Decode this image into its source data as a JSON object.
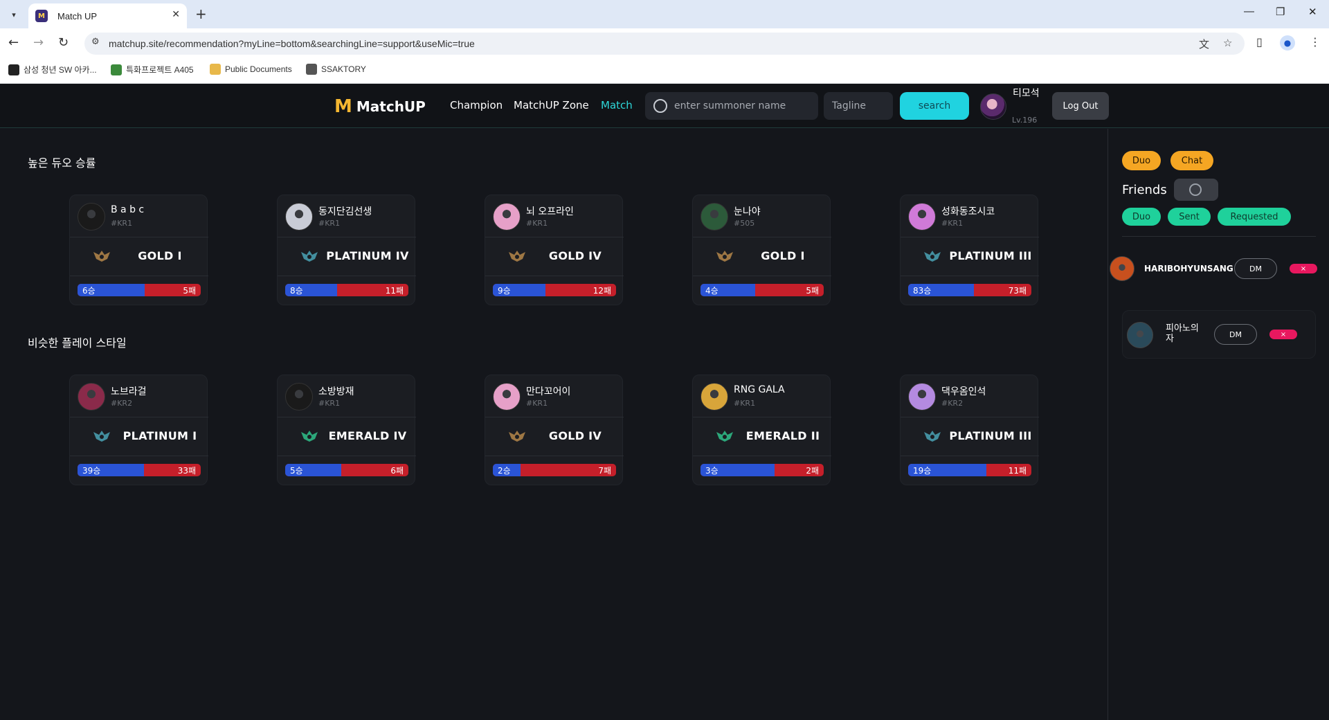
{
  "browser": {
    "tab_title": "Match UP",
    "url": "matchup.site/recommendation?myLine=bottom&searchingLine=support&useMic=true",
    "bookmarks": [
      {
        "label": "삼성 청년 SW 아카..."
      },
      {
        "label": "특화프로젝트 A405"
      },
      {
        "label": "Public Documents"
      },
      {
        "label": "SSAKTORY"
      }
    ]
  },
  "header": {
    "logo_mark": "M",
    "logo_text": "MatchUP",
    "nav": [
      {
        "label": "Champion"
      },
      {
        "label": "MatchUP Zone"
      },
      {
        "label": "Match"
      }
    ],
    "search_placeholder": "enter summoner name",
    "tagline_placeholder": "Tagline",
    "search_label": "search",
    "user_name": "티모석",
    "user_level": "Lv.196",
    "logout_label": "Log Out"
  },
  "sections": [
    {
      "title": "높은 듀오 승률",
      "cards": [
        {
          "name": "B a b c",
          "tag": "#KR1",
          "tier": "GOLD I",
          "tier_color": "#b5874a",
          "wins": "6승",
          "losses": "5패",
          "win_ratio": 0.545,
          "avatar_color": "#1a1a1a"
        },
        {
          "name": "동지단김선생",
          "tag": "#KR1",
          "tier": "PLATINUM IV",
          "tier_color": "#4aa3b5",
          "wins": "8승",
          "losses": "11패",
          "win_ratio": 0.421,
          "avatar_color": "#c9ccd6"
        },
        {
          "name": "뇌 오프라인",
          "tag": "#KR1",
          "tier": "GOLD IV",
          "tier_color": "#b5874a",
          "wins": "9승",
          "losses": "12패",
          "win_ratio": 0.429,
          "avatar_color": "#e6a0c8"
        },
        {
          "name": "눈나야",
          "tag": "#505",
          "tier": "GOLD I",
          "tier_color": "#b5874a",
          "wins": "4승",
          "losses": "5패",
          "win_ratio": 0.444,
          "avatar_color": "#2c5a3a"
        },
        {
          "name": "성화동조시코",
          "tag": "#KR1",
          "tier": "PLATINUM III",
          "tier_color": "#4aa3b5",
          "wins": "83승",
          "losses": "73패",
          "win_ratio": 0.532,
          "avatar_color": "#d07ad8"
        }
      ]
    },
    {
      "title": "비슷한 플레이 스타일",
      "cards": [
        {
          "name": "노브라걸",
          "tag": "#KR2",
          "tier": "PLATINUM I",
          "tier_color": "#4aa3b5",
          "wins": "39승",
          "losses": "33패",
          "win_ratio": 0.542,
          "avatar_color": "#8a2a4a"
        },
        {
          "name": "소방방재",
          "tag": "#KR1",
          "tier": "EMERALD IV",
          "tier_color": "#2fbf8a",
          "wins": "5승",
          "losses": "6패",
          "win_ratio": 0.455,
          "avatar_color": "#1a1a1a"
        },
        {
          "name": "만다꼬어이",
          "tag": "#KR1",
          "tier": "GOLD IV",
          "tier_color": "#b5874a",
          "wins": "2승",
          "losses": "7패",
          "win_ratio": 0.222,
          "avatar_color": "#e6a0c8"
        },
        {
          "name": "RNG GALA",
          "tag": "#KR1",
          "tier": "EMERALD II",
          "tier_color": "#2fbf8a",
          "wins": "3승",
          "losses": "2패",
          "win_ratio": 0.6,
          "avatar_color": "#d8a53a"
        },
        {
          "name": "댁우옴인석",
          "tag": "#KR2",
          "tier": "PLATINUM III",
          "tier_color": "#4aa3b5",
          "wins": "19승",
          "losses": "11패",
          "win_ratio": 0.633,
          "avatar_color": "#b48ae0"
        }
      ]
    }
  ],
  "side": {
    "duo_label": "Duo",
    "chat_label": "Chat",
    "friends_label": "Friends",
    "filter_duo": "Duo",
    "filter_sent": "Sent",
    "filter_requested": "Requested",
    "dm_label": "DM",
    "remove_label": "×",
    "friends": [
      {
        "name": "HARIBOHYUNSANG",
        "avatar_color": "#c8501e"
      },
      {
        "name": "피아노의 자",
        "avatar_color": "#2a4a5a"
      }
    ]
  }
}
